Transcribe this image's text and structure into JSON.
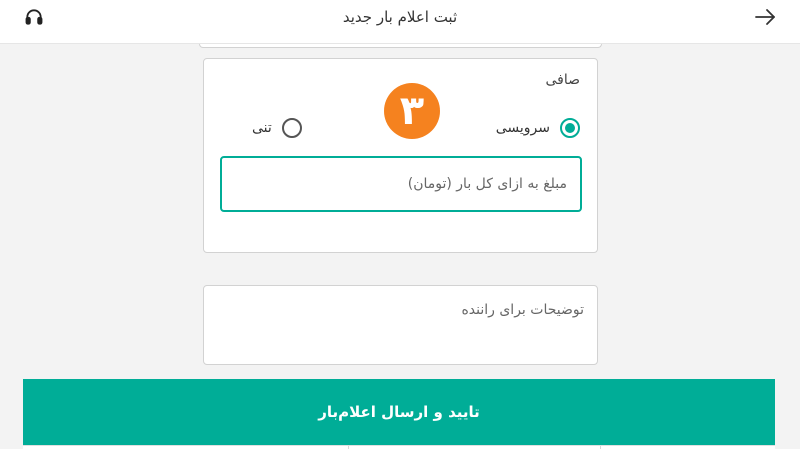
{
  "header": {
    "title": "ثبت اعلام بار جدید",
    "back_icon": "arrow-right-icon",
    "support_icon": "headset-icon"
  },
  "pricing": {
    "label": "صافی",
    "step_number": "۳",
    "options": [
      {
        "label": "سرویسی",
        "selected": true
      },
      {
        "label": "تنی",
        "selected": false
      }
    ],
    "price_placeholder": "مبلغ به ازای کل بار (تومان)"
  },
  "notes": {
    "placeholder": "توضیحات برای راننده"
  },
  "actions": {
    "submit_label": "تایید و ارسال اعلام‌بار"
  },
  "colors": {
    "accent": "#00ad97",
    "badge": "#f5821f"
  }
}
